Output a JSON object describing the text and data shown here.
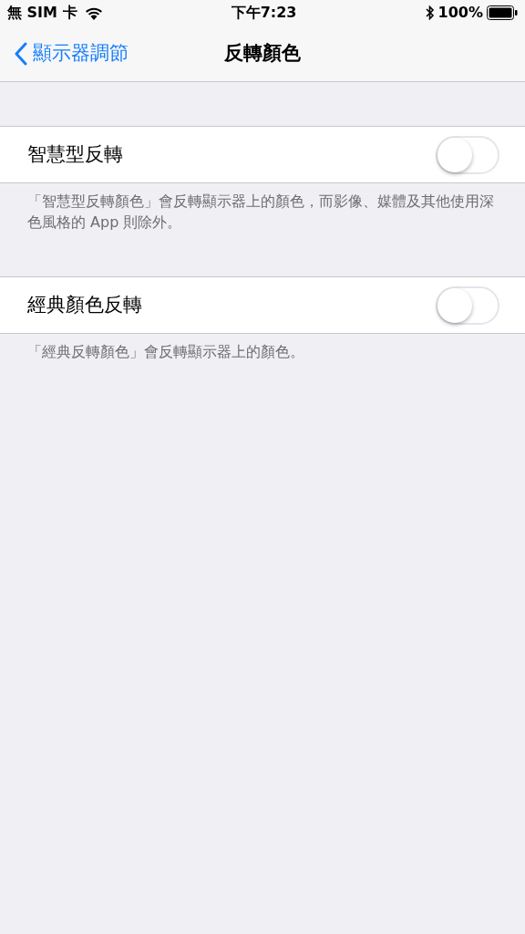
{
  "status_bar": {
    "carrier": "無 SIM 卡",
    "time": "下午7:23",
    "battery": "100%"
  },
  "nav": {
    "back": "顯示器調節",
    "title": "反轉顏色"
  },
  "sections": [
    {
      "label": "智慧型反轉",
      "on": false,
      "footer": "「智慧型反轉顏色」會反轉顯示器上的顏色，而影像、媒體及其他使用深色風格的 App 則除外。"
    },
    {
      "label": "經典顏色反轉",
      "on": false,
      "footer": "「經典反轉顏色」會反轉顯示器上的顏色。"
    }
  ]
}
